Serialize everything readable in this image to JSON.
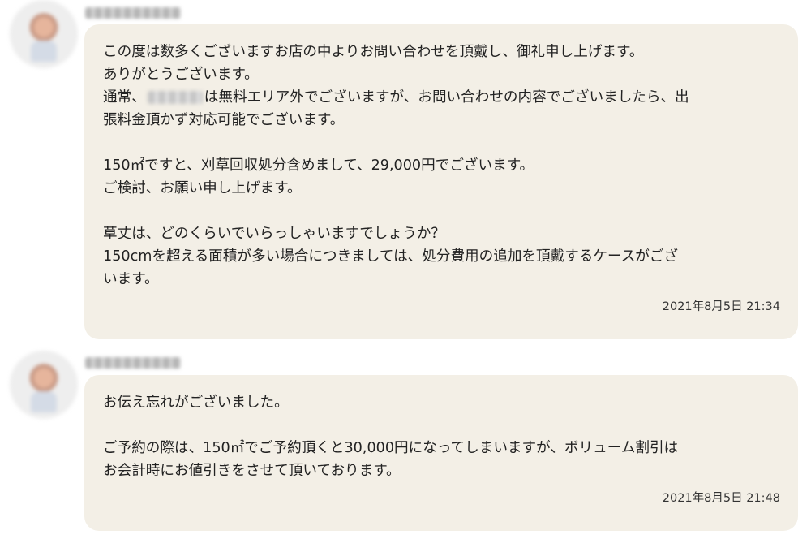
{
  "messages": [
    {
      "sender": "",
      "lines": [
        "この度は数多くございますお店の中よりお問い合わせを頂戴し、御礼申し上げます。",
        "ありがとうございます。",
        "通常、",
        "張料金頂かず対応可能でございます。",
        "",
        "150㎡ですと、刈草回収処分含めまして、29,000円でございます。",
        "ご検討、お願い申し上げます。",
        "",
        "草丈は、どのくらいでいらっしゃいますでしょうか？",
        "150cmを超える面積が多い場合につきましては、処分費用の追加を頂戴するケースがござ",
        "います。"
      ],
      "line3_after_blur": "は無料エリア外でございますが、お問い合わせの内容でございましたら、出",
      "timestamp": "2021年8月5日 21:34"
    },
    {
      "sender": "",
      "lines": [
        "お伝え忘れがございました。",
        "",
        "ご予約の際は、150㎡でご予約頂くと30,000円になってしまいますが、ボリューム割引は",
        "お会計時にお値引きをさせて頂いております。"
      ],
      "timestamp": "2021年8月5日 21:48"
    }
  ]
}
